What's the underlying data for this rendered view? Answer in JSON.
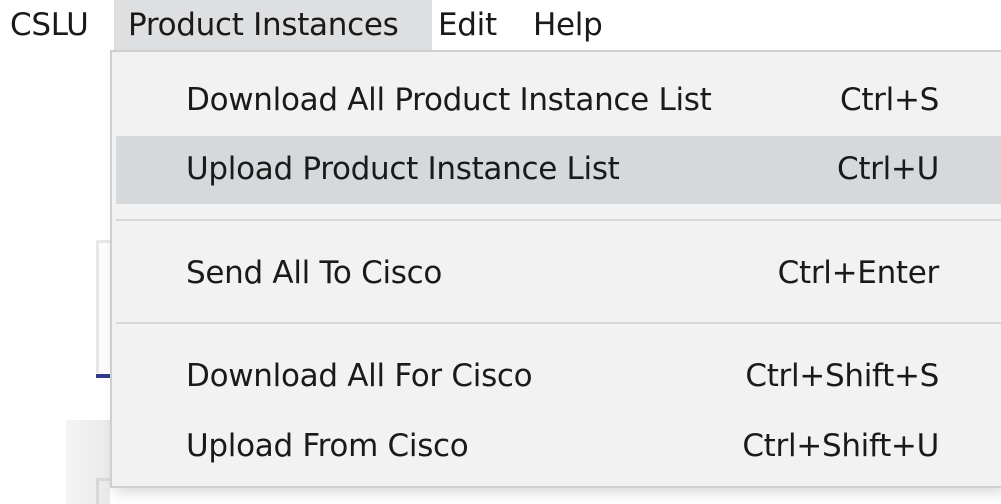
{
  "menubar": {
    "app": "CSLU",
    "product_instances": "Product Instances",
    "edit": "Edit",
    "help": "Help"
  },
  "dropdown": {
    "items": [
      {
        "label": "Download All Product Instance List",
        "shortcut": "Ctrl+S"
      },
      {
        "label": "Upload Product Instance List",
        "shortcut": "Ctrl+U"
      },
      {
        "label": "Send All To Cisco",
        "shortcut": "Ctrl+Enter"
      },
      {
        "label": "Download All For Cisco",
        "shortcut": "Ctrl+Shift+S"
      },
      {
        "label": "Upload From Cisco",
        "shortcut": "Ctrl+Shift+U"
      }
    ],
    "highlighted_index": 1
  },
  "colors": {
    "menu_background": "#f2f2f2",
    "highlight": "#d6d9db",
    "active_menubar": "#dddfe1",
    "text": "#1a1a1a"
  }
}
